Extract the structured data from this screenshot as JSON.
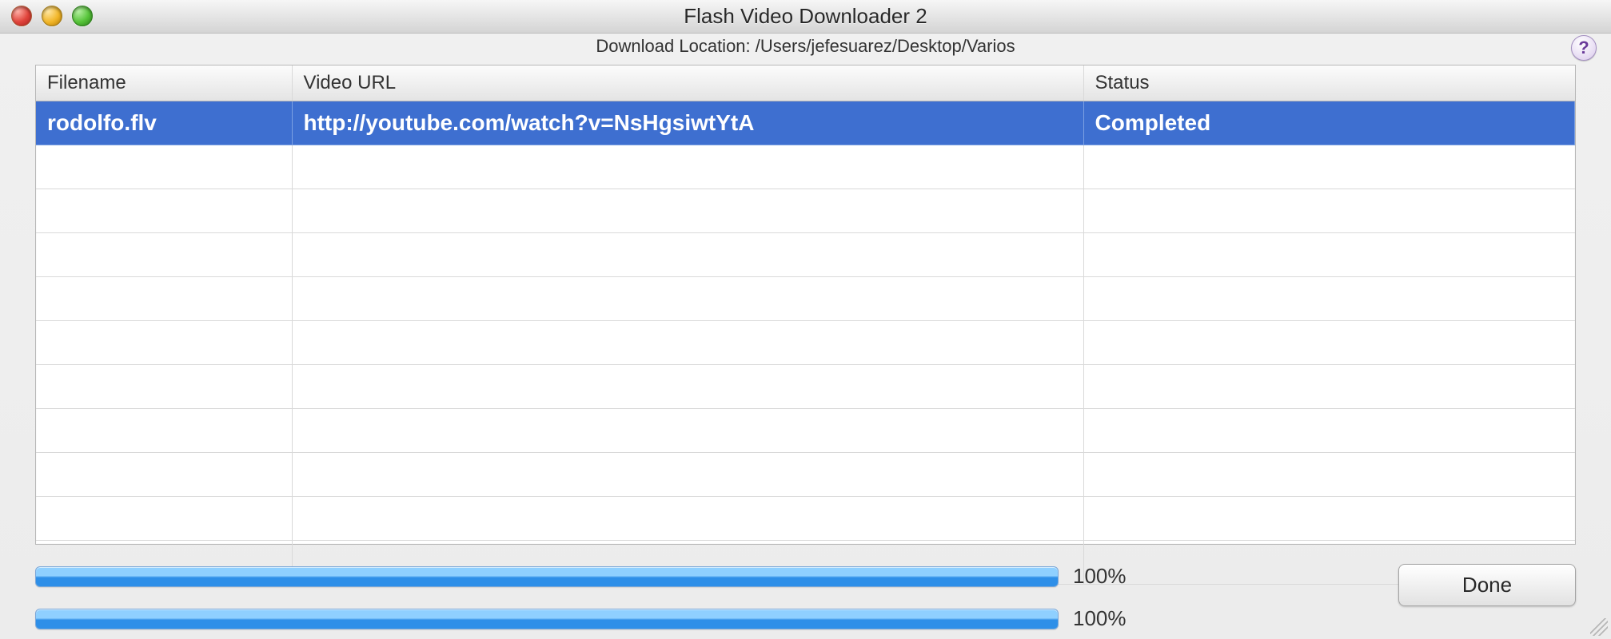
{
  "window": {
    "title": "Flash Video Downloader 2",
    "download_location_label": "Download Location: /Users/jefesuarez/Desktop/Varios",
    "help_glyph": "?"
  },
  "table": {
    "columns": {
      "filename": "Filename",
      "video_url": "Video URL",
      "status": "Status"
    },
    "rows": [
      {
        "filename": "rodolfo.flv",
        "video_url": "http://youtube.com/watch?v=NsHgsiwtYtA",
        "status": "Completed",
        "selected": true
      }
    ],
    "empty_row_count": 10
  },
  "progress": {
    "bar1_percent_label": "100%",
    "bar2_percent_label": "100%"
  },
  "buttons": {
    "done": "Done"
  },
  "colors": {
    "selection_blue": "#3e6fd0",
    "progress_light": "#8fd0ff",
    "progress_dark": "#2e8fe8"
  }
}
